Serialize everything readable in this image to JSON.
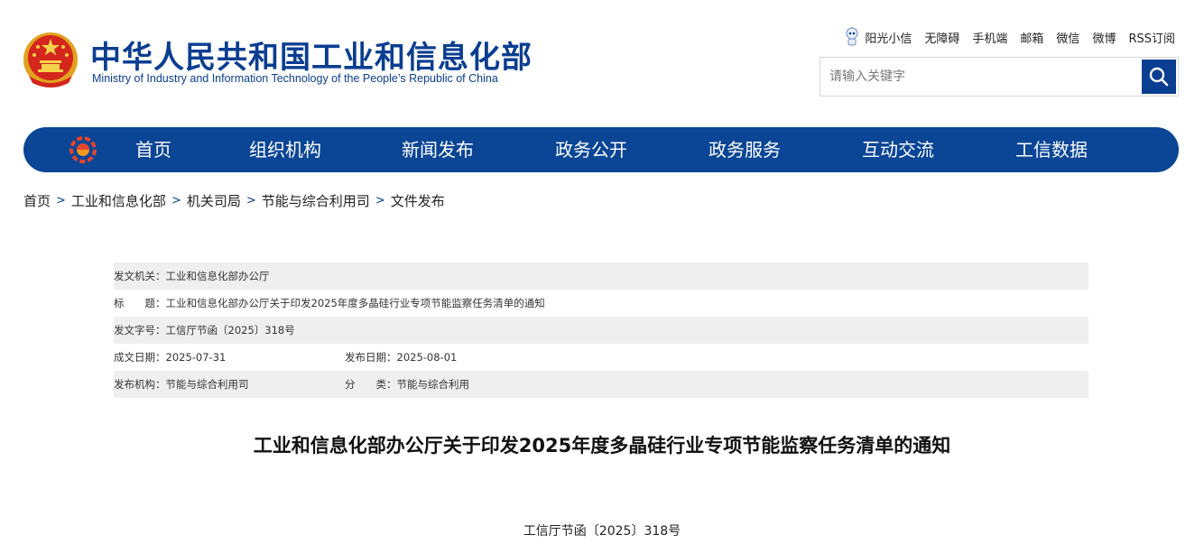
{
  "header": {
    "title_cn": "中华人民共和国工业和信息化部",
    "title_en": "Ministry of Industry and Information Technology of the People’s Republic of China",
    "top_links": [
      "阳光小信",
      "无障碍",
      "手机端",
      "邮箱",
      "微信",
      "微博",
      "RSS订阅"
    ],
    "search": {
      "placeholder": "请输入关键字"
    }
  },
  "nav": {
    "items": [
      "首页",
      "组织机构",
      "新闻发布",
      "政务公开",
      "政务服务",
      "互动交流",
      "工信数据"
    ]
  },
  "breadcrumb": [
    "首页",
    "工业和信息化部",
    "机关司局",
    "节能与综合利用司",
    "文件发布"
  ],
  "meta": {
    "issuer_label": "发文机关：",
    "issuer": "工业和信息化部办公厅",
    "title_label": "标　　题：",
    "title": "工业和信息化部办公厅关于印发2025年度多晶硅行业专项节能监察任务清单的通知",
    "doc_no_label": "发文字号：",
    "doc_no": "工信厅节函〔2025〕318号",
    "date_written_label": "成文日期：",
    "date_written": "2025-07-31",
    "date_published_label": "发布日期：",
    "date_published": "2025-08-01",
    "org_label": "发布机构：",
    "org": "节能与综合利用司",
    "category_label": "分　　类：",
    "category": "节能与综合利用"
  },
  "article": {
    "title": "工业和信息化部办公厅关于印发2025年度多晶硅行业专项节能监察任务清单的通知",
    "doc_number": "工信厅节函〔2025〕318号"
  },
  "colors": {
    "brand_blue": "#0a3e91",
    "nav_blue": "#0a4596",
    "meta_shade": "#efefef"
  }
}
